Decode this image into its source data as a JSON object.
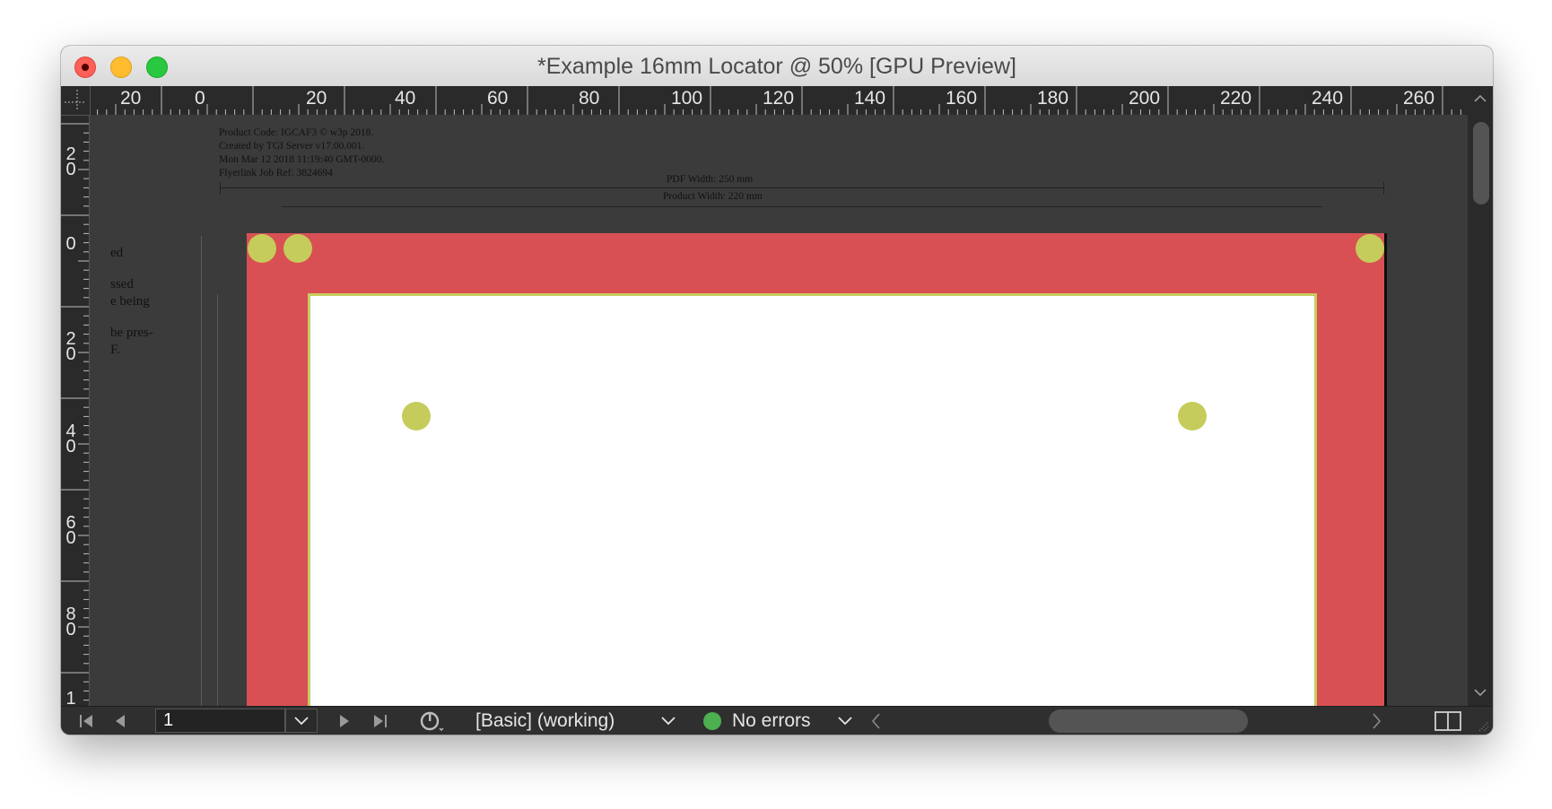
{
  "window": {
    "title": "*Example 16mm Locator @ 50% [GPU Preview]"
  },
  "ruler": {
    "top_labels": [
      "20",
      "0",
      "20",
      "40",
      "60",
      "80",
      "100",
      "120",
      "140",
      "160",
      "180",
      "200",
      "220",
      "240",
      "260"
    ],
    "left_labels": [
      [
        "2",
        "0"
      ],
      [
        "0"
      ],
      [
        "2",
        "0"
      ],
      [
        "4",
        "0"
      ],
      [
        "6",
        "0"
      ],
      [
        "8",
        "0"
      ],
      [
        "1"
      ]
    ]
  },
  "document": {
    "info_lines": [
      "Product Code: IGCAF3 © w3p 2018.",
      "Created by TGI Server v17.00.001.",
      "Mon Mar 12 2018 11:19:40 GMT-0000.",
      "Flyerlink Job Ref: 3824694"
    ],
    "pdf_width_label": "PDF Width: 250 mm",
    "product_width_label": "Product Width: 220 mm",
    "side_notes": [
      "ed",
      "ssed",
      "e being",
      "be pres-",
      "F."
    ],
    "colors": {
      "bleed": "#d95054",
      "trim_border": "#c6cc5f",
      "locator": "#c5cc5b",
      "page": "#ffffff",
      "pasteboard": "#3b3b3b"
    }
  },
  "statusbar": {
    "page_number": "1",
    "preflight_profile": "[Basic] (working)",
    "preflight_status": "No errors",
    "preflight_status_color": "#4caf50"
  }
}
